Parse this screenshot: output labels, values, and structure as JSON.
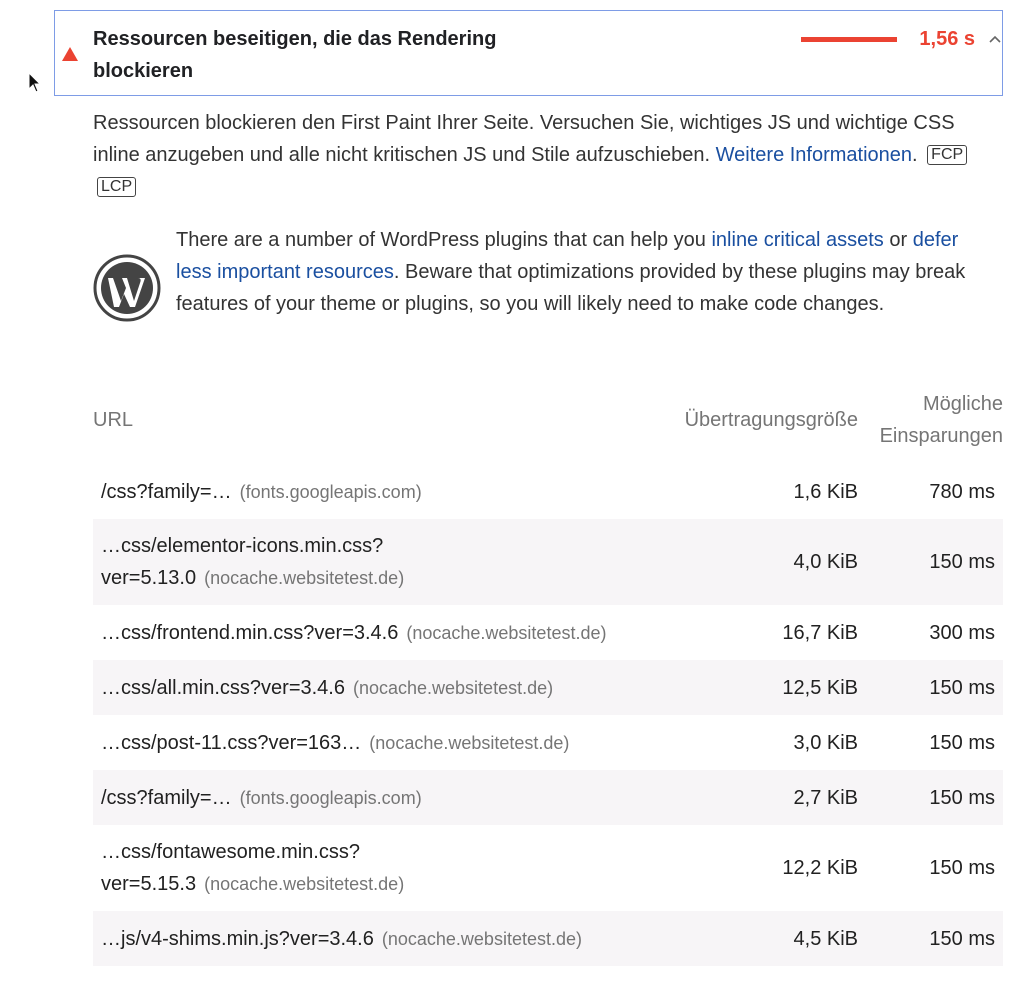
{
  "audit": {
    "title": "Ressourcen beseitigen, die das Rendering blockieren",
    "value": "1,56 s",
    "status_color": "#eb4332",
    "status_icon": "fail-triangle-icon",
    "expand_icon": "chevron-up-icon"
  },
  "description": {
    "text": "Ressourcen blockieren den First Paint Ihrer Seite. Versuchen Sie, wichtiges JS und wichtige CSS inline anzugeben und alle nicht kritischen JS und Stile aufzuschieben.",
    "link_text": "Weitere Informationen",
    "tags": [
      "FCP",
      "LCP"
    ]
  },
  "stack_pack": {
    "icon": "wordpress-icon",
    "text_1": "There are a number of WordPress plugins that can help you",
    "link_1": "inline critical assets",
    "text_2": "or",
    "link_2": "defer less important resources",
    "text_3": ". Beware that optimizations provided by these plugins may break features of your theme or plugins, so you will likely need to make code changes."
  },
  "table": {
    "headers": {
      "url": "URL",
      "size": "Übertragungsgröße",
      "savings_1": "Mögliche",
      "savings_2": "Einsparungen"
    },
    "rows": [
      {
        "url": "/css?family=…",
        "url_2": "",
        "origin": "(fonts.googleapis.com)",
        "size": "1,6 KiB",
        "savings": "780 ms"
      },
      {
        "url": "…css/elementor-icons.min.css?",
        "url_2": "ver=5.13.0",
        "origin": "(nocache.websitetest.de)",
        "size": "4,0 KiB",
        "savings": "150 ms"
      },
      {
        "url": "…css/frontend.min.css?ver=3.4.6",
        "url_2": "",
        "origin": "(nocache.websitetest.de)",
        "size": "16,7 KiB",
        "savings": "300 ms"
      },
      {
        "url": "…css/all.min.css?ver=3.4.6",
        "url_2": "",
        "origin": "(nocache.websitetest.de)",
        "size": "12,5 KiB",
        "savings": "150 ms"
      },
      {
        "url": "…css/post-11.css?ver=163…",
        "url_2": "",
        "origin": "(nocache.websitetest.de)",
        "size": "3,0 KiB",
        "savings": "150 ms"
      },
      {
        "url": "/css?family=…",
        "url_2": "",
        "origin": "(fonts.googleapis.com)",
        "size": "2,7 KiB",
        "savings": "150 ms"
      },
      {
        "url": "…css/fontawesome.min.css?",
        "url_2": "ver=5.15.3",
        "origin": "(nocache.websitetest.de)",
        "size": "12,2 KiB",
        "savings": "150 ms"
      },
      {
        "url": "…js/v4-shims.min.js?ver=3.4.6",
        "url_2": "",
        "origin": "(nocache.websitetest.de)",
        "size": "4,5 KiB",
        "savings": "150 ms"
      }
    ]
  }
}
